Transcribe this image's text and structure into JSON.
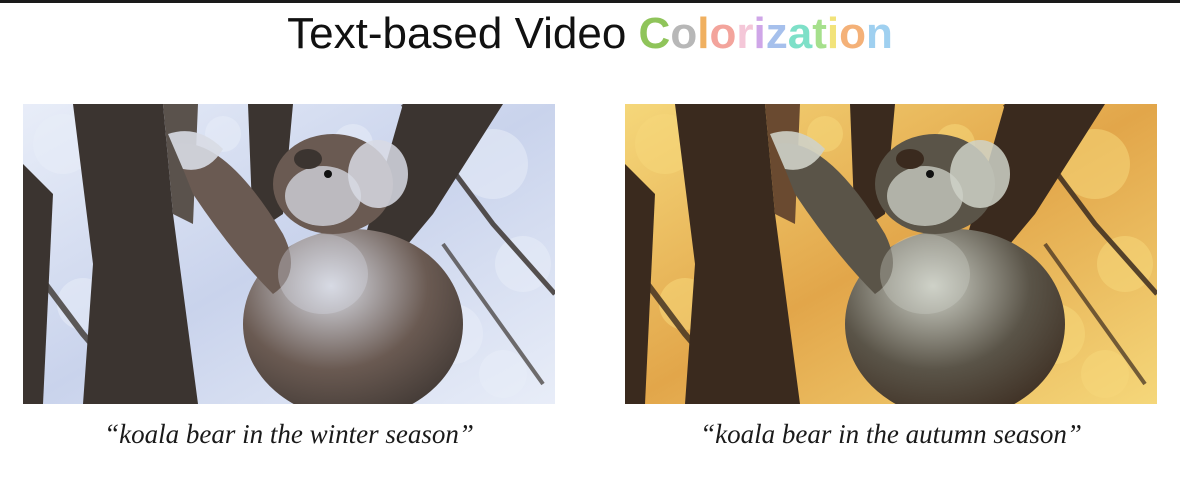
{
  "title": {
    "plain_text": "Text-based Video ",
    "colored_word": "Colorization",
    "letter_colors": [
      "#8fc45a",
      "#b7b7b7",
      "#f0b060",
      "#f3a49c",
      "#f4c7d8",
      "#cfa6e8",
      "#a6c0ec",
      "#7ee0c8",
      "#a6e08c",
      "#f2e37a",
      "#f4b178",
      "#9fd0f0"
    ]
  },
  "panels": [
    {
      "caption": "“koala bear in the winter season”",
      "palette": {
        "sky": "#c9d3ec",
        "sky_light": "#e8edf8",
        "trunk": "#3b3430",
        "trunk_light": "#5a524c",
        "fur": "#6a5a52",
        "fur_light": "#d8dbe4"
      }
    },
    {
      "caption": "“koala bear in the autumn season”",
      "palette": {
        "sky": "#e2a64a",
        "sky_light": "#f5d77a",
        "trunk": "#3a2a1e",
        "trunk_light": "#6a4a30",
        "fur": "#5a5448",
        "fur_light": "#cfd2c8"
      }
    }
  ]
}
